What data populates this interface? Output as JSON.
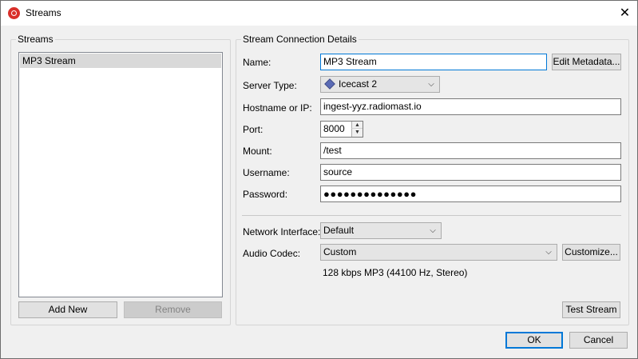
{
  "window": {
    "title": "Streams",
    "close_glyph": "✕",
    "app_icon": "broadcast-icon"
  },
  "streams_panel": {
    "legend": "Streams",
    "items": [
      "MP3 Stream"
    ],
    "add_label": "Add New",
    "remove_label": "Remove"
  },
  "details": {
    "legend": "Stream Connection Details",
    "name_label": "Name:",
    "name_value": "MP3 Stream",
    "edit_metadata_label": "Edit Metadata...",
    "server_type_label": "Server Type:",
    "server_type_value": "Icecast 2",
    "hostname_label": "Hostname or IP:",
    "hostname_value": "ingest-yyz.radiomast.io",
    "port_label": "Port:",
    "port_value": "8000",
    "mount_label": "Mount:",
    "mount_value": "/test",
    "username_label": "Username:",
    "username_value": "source",
    "password_label": "Password:",
    "password_value": "●●●●●●●●●●●●●●",
    "network_interface_label": "Network Interface:",
    "network_interface_value": "Default",
    "audio_codec_label": "Audio Codec:",
    "audio_codec_value": "Custom",
    "customize_label": "Customize...",
    "codec_summary": "128 kbps MP3 (44100 Hz, Stereo)",
    "test_stream_label": "Test Stream"
  },
  "footer": {
    "ok_label": "OK",
    "cancel_label": "Cancel"
  },
  "colors": {
    "window_bg": "#f0f0f0",
    "accent": "#0078d7",
    "app_icon": "#d9302a"
  }
}
